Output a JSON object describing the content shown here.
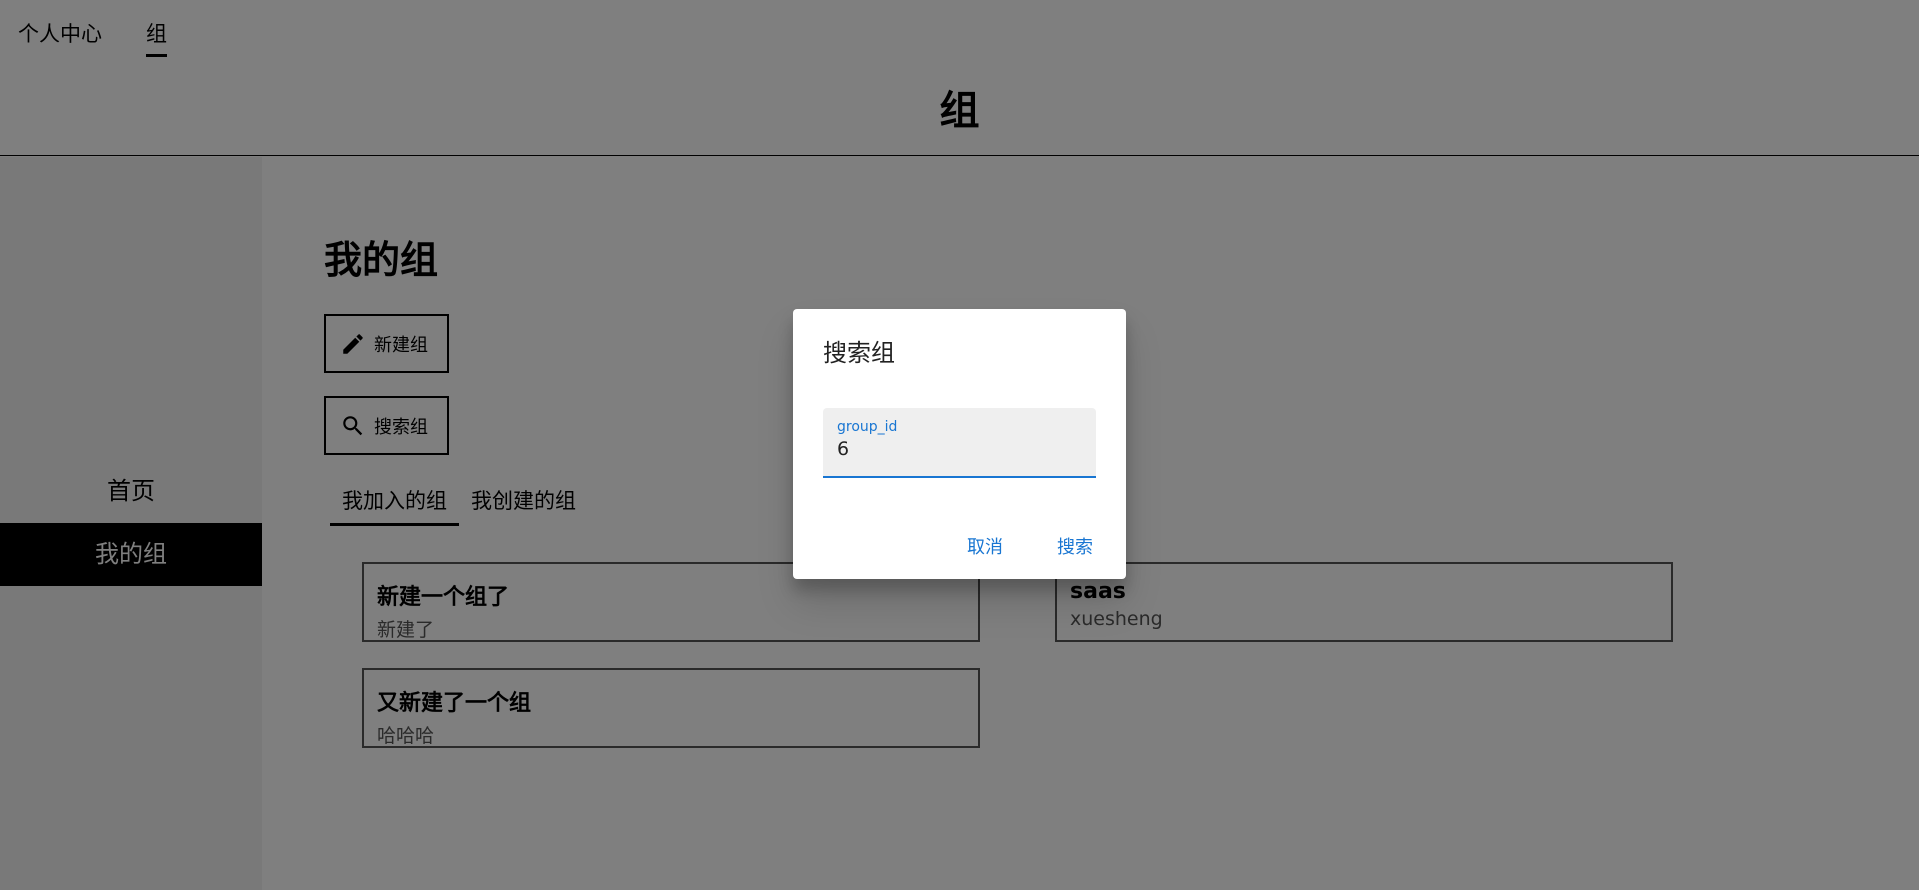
{
  "topnav": {
    "items": [
      {
        "label": "个人中心",
        "active": false
      },
      {
        "label": "组",
        "active": true
      }
    ]
  },
  "header": {
    "title": "组"
  },
  "sidebar": {
    "items": [
      {
        "label": "首页",
        "active": false
      },
      {
        "label": "我的组",
        "active": true
      }
    ]
  },
  "main": {
    "title": "我的组",
    "new_group_label": "新建组",
    "search_group_label": "搜索组",
    "tabs": [
      {
        "label": "我加入的组",
        "active": true
      },
      {
        "label": "我创建的组",
        "active": false
      }
    ],
    "groups": [
      {
        "name": "新建一个组了",
        "description": "新建了"
      },
      {
        "name": "saas",
        "description": "xuesheng"
      },
      {
        "name": "又新建了一个组",
        "description": "哈哈哈"
      }
    ]
  },
  "dialog": {
    "title": "搜索组",
    "field_label": "group_id",
    "field_value": "6",
    "cancel_label": "取消",
    "search_label": "搜索"
  },
  "colors": {
    "accent": "#1976d2",
    "overlay": "rgba(0,0,0,0.5)",
    "sidebar_active_bg": "#000000"
  },
  "icons": {
    "new_group": "pencil-icon",
    "search_group": "search-icon"
  }
}
